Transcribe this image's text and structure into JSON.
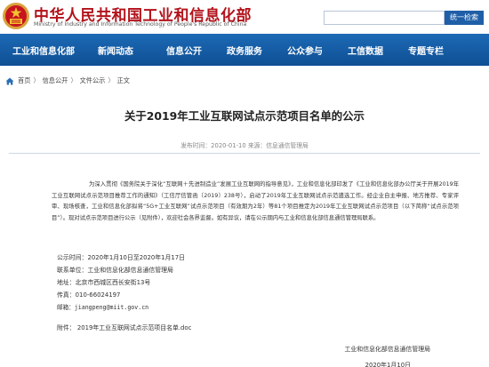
{
  "header": {
    "title": "中华人民共和国工业和信息化部",
    "subtitle": "Ministry of Industry and Information Technology of People's Republic of China",
    "search_placeholder": "",
    "search_button": "统一检索"
  },
  "nav": {
    "items": [
      "工业和信息化部",
      "新闻动态",
      "信息公开",
      "政务服务",
      "公众参与",
      "工信数据",
      "专题专栏"
    ]
  },
  "breadcrumb": {
    "items": [
      "首页",
      "信息公开",
      "文件公示",
      "正文"
    ],
    "separator": "〉"
  },
  "article": {
    "title": "关于2019年工业互联网试点示范项目名单的公示",
    "meta": "发布时间：2020-01-10    来源：信息通信管理局",
    "paragraph": "为深入贯彻《国务院关于深化“互联网＋先进制造业”发展工业互联网的指导意见》，工业和信息化部印发了《工业和信息化部办公厅关于开展2019年工业互联网试点示范项目推荐工作的通知》（工信厅信管函〔2019〕238号），启动了2019年工业互联网试点示范遴选工作。经企业自主申报、地方推荐、专家评审、现场核查，工业和信息化部拟将“5G+工业互联网”试点示范项目（有效期为2年）等81个项目推定为2019年工业互联网试点示范项目（以下简称“试点示范项目”）。现对试点示范项目进行公示（见附件），欢迎社会各界监督。如有异议，请在公示期内与工业和信息化部信息通信管理局联系。",
    "info": {
      "period": "公示时间：2020年1月10日至2020年1月17日",
      "contact_unit": "联系单位：工业和信息化部信息通信管理局",
      "address": "地址：北京市西城区西长安街13号",
      "fax": "传真：010-66024197",
      "email": "邮箱：jiangpeng@miit.gov.cn",
      "attachment": "附件：   2019年工业互联网试点示范项目名单.doc"
    },
    "signature": "工业和信息化部信息通信管理局",
    "date": "2020年1月10日"
  }
}
